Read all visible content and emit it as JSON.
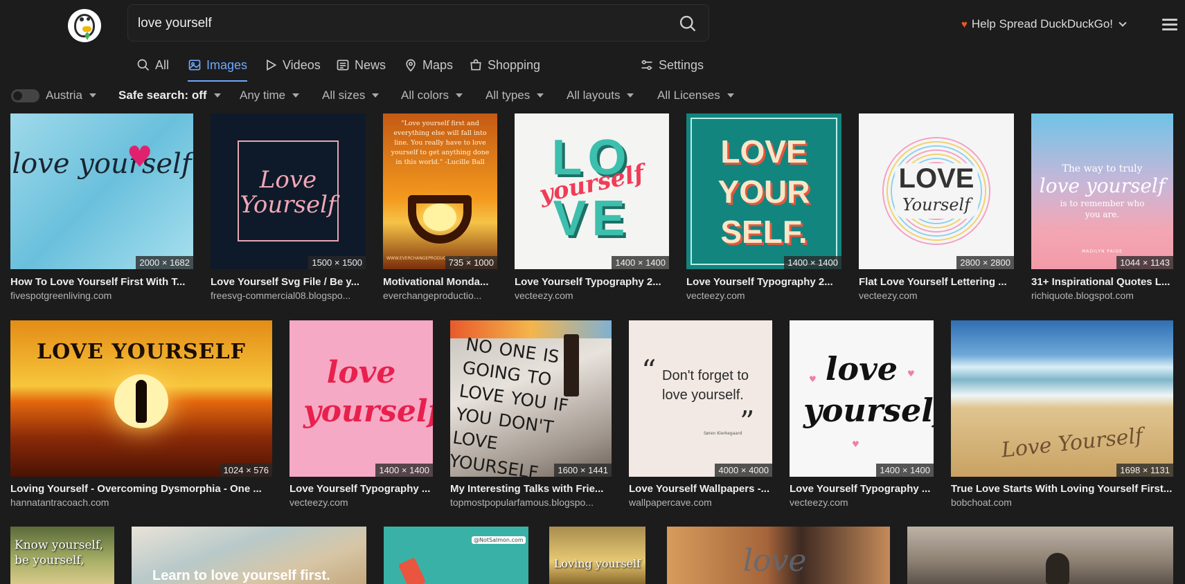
{
  "search": {
    "query": "love yourself"
  },
  "header": {
    "help_text": "Help Spread DuckDuckGo!"
  },
  "tabs": [
    {
      "label": "All",
      "icon": "search-icon",
      "active": false
    },
    {
      "label": "Images",
      "icon": "image-icon",
      "active": true
    },
    {
      "label": "Videos",
      "icon": "play-icon",
      "active": false
    },
    {
      "label": "News",
      "icon": "newspaper-icon",
      "active": false
    },
    {
      "label": "Maps",
      "icon": "map-pin-icon",
      "active": false
    },
    {
      "label": "Shopping",
      "icon": "shopping-bag-icon",
      "active": false
    }
  ],
  "settings_label": "Settings",
  "filters": {
    "region": "Austria",
    "safe_search": "Safe search: off",
    "time": "Any time",
    "size": "All sizes",
    "color": "All colors",
    "type": "All types",
    "layout": "All layouts",
    "license": "All Licenses"
  },
  "results": [
    {
      "title": "How To Love Yourself First With T...",
      "source": "fivespotgreenliving.com",
      "dims": "2000 × 1682",
      "art": "love yourself"
    },
    {
      "title": "Love Yourself Svg File / Be y...",
      "source": "freesvg-commercial08.blogspo...",
      "dims": "1500 × 1500",
      "art": "Love Yourself"
    },
    {
      "title": "Motivational Monda...",
      "source": "everchangeproductio...",
      "dims": "735 × 1000",
      "art": "\"Love yourself first and everything else will fall into line. You really have to love yourself to get anything done in this world.\" -Lucille Ball",
      "art_credit": "WWW.EVERCHANGEPRODUCTIONS.COM"
    },
    {
      "title": "Love Yourself Typography 2...",
      "source": "vecteezy.com",
      "dims": "1400 × 1400",
      "art": "LO VE",
      "art2": "yourself"
    },
    {
      "title": "Love Yourself Typography 2...",
      "source": "vecteezy.com",
      "dims": "1400 × 1400",
      "art": "LOVE YOUR SELF."
    },
    {
      "title": "Flat Love Yourself Lettering ...",
      "source": "vecteezy.com",
      "dims": "2800 × 2800",
      "art": "LOVE",
      "art2": "Yourself"
    },
    {
      "title": "31+ Inspirational Quotes L...",
      "source": "richiquote.blogspot.com",
      "dims": "1044 × 1143",
      "art": "The way to truly",
      "art2": "love yourself",
      "art3": "is to remember who you are.",
      "art_credit": "MADILYN PAIGE"
    },
    {
      "title": "Loving Yourself - Overcoming Dysmorphia - One ...",
      "source": "hannatantracoach.com",
      "dims": "1024 × 576",
      "art": "LOVE YOURSELF"
    },
    {
      "title": "Love Yourself Typography ...",
      "source": "vecteezy.com",
      "dims": "1400 × 1400",
      "art": "love yourself"
    },
    {
      "title": "My Interesting Talks with Frie...",
      "source": "topmostpopularfamous.blogspo...",
      "dims": "1600 × 1441",
      "art": "NO ONE IS GOING TO LOVE YOU IF YOU DON'T LOVE YOURSELF"
    },
    {
      "title": "Love Yourself Wallpapers -...",
      "source": "wallpapercave.com",
      "dims": "4000 × 4000",
      "art": "Don't forget to love yourself.",
      "art_credit": "Søren Kierkegaard"
    },
    {
      "title": "Love Yourself Typography ...",
      "source": "vecteezy.com",
      "dims": "1400 × 1400",
      "art": "love yourself"
    },
    {
      "title": "True Love Starts With Loving Yourself First...",
      "source": "bobchoat.com",
      "dims": "1698 × 1131",
      "art": "Love Yourself"
    },
    {
      "art": "Know yourself, be yourself,"
    },
    {
      "art": "Learn to love yourself first."
    },
    {
      "art": "@NotSalmon.com"
    },
    {
      "art": "Loving yourself"
    },
    {
      "art": "love"
    },
    {
      "art": ""
    }
  ]
}
